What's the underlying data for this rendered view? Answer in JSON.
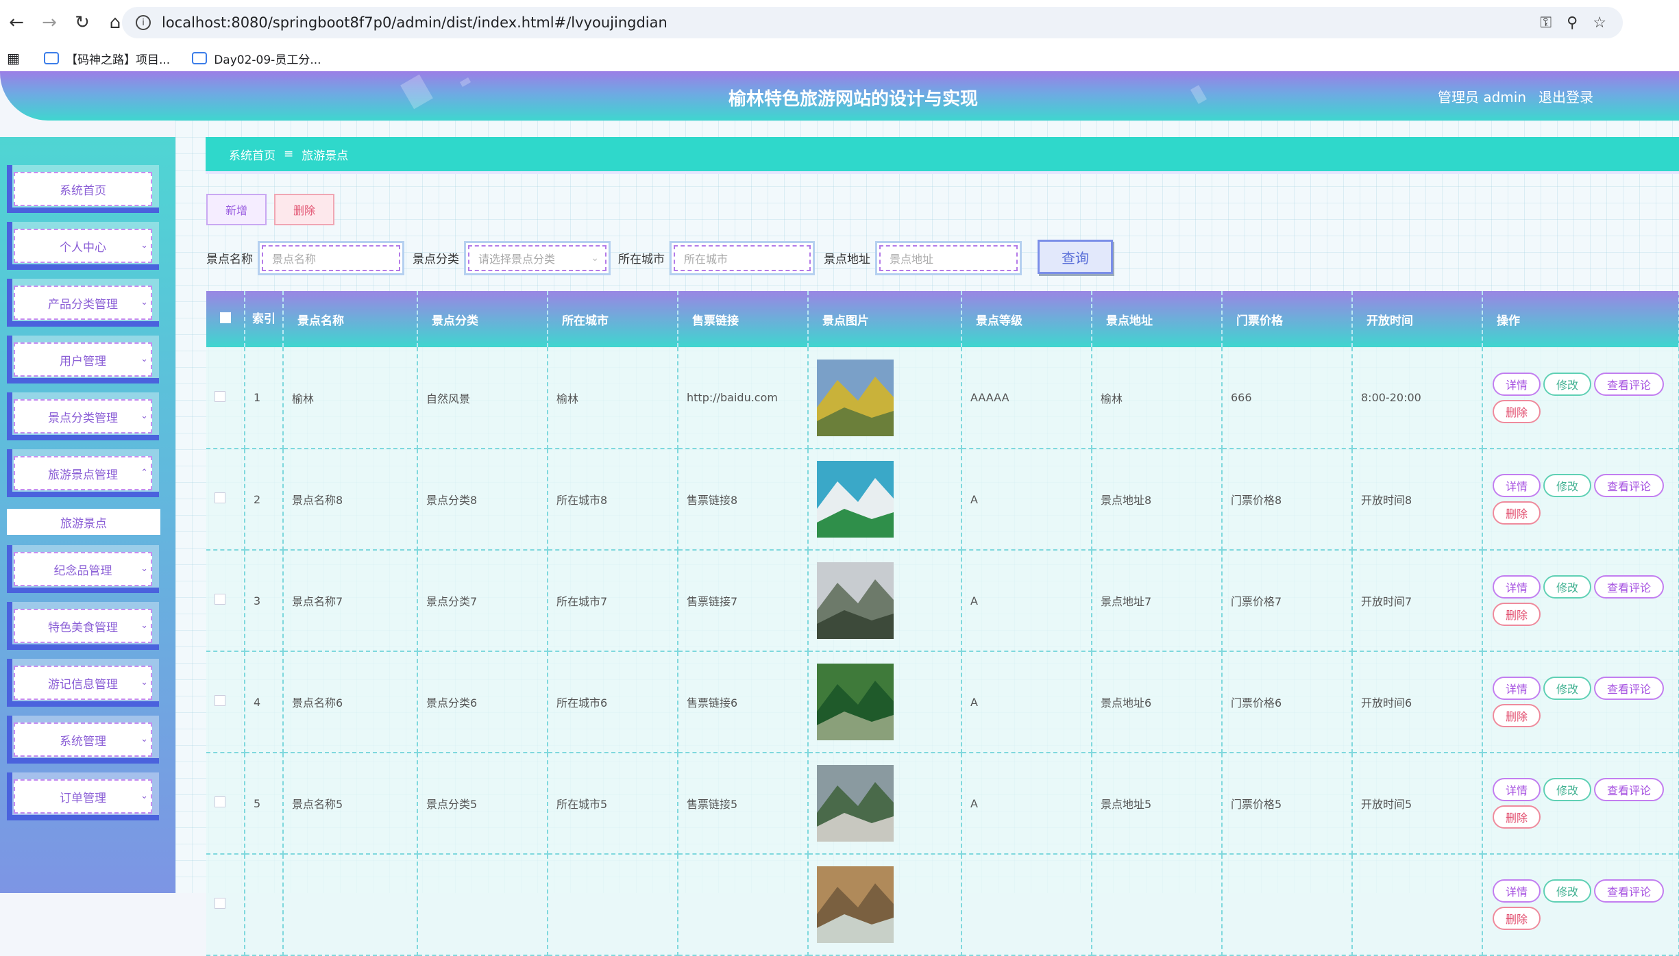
{
  "browser": {
    "url": "localhost:8080/springboot8f7p0/admin/dist/index.html#/lvyoujingdian",
    "bookmarks": [
      "【码神之路】项目...",
      "Day02-09-员工分..."
    ]
  },
  "header": {
    "title": "榆林特色旅游网站的设计与实现",
    "user": "管理员 admin",
    "logout": "退出登录"
  },
  "sidebar": {
    "items": [
      {
        "label": "系统首页"
      },
      {
        "label": "个人中心"
      },
      {
        "label": "产品分类管理"
      },
      {
        "label": "用户管理"
      },
      {
        "label": "景点分类管理"
      },
      {
        "label": "旅游景点管理"
      },
      {
        "label": "纪念品管理"
      },
      {
        "label": "特色美食管理"
      },
      {
        "label": "游记信息管理"
      },
      {
        "label": "系统管理"
      },
      {
        "label": "订单管理"
      }
    ],
    "active_sub": "旅游景点"
  },
  "breadcrumb": {
    "home": "系统首页",
    "current": "旅游景点"
  },
  "toolbar": {
    "add": "新增",
    "delete": "删除"
  },
  "filters": {
    "name_label": "景点名称",
    "name_placeholder": "景点名称",
    "category_label": "景点分类",
    "category_placeholder": "请选择景点分类",
    "city_label": "所在城市",
    "city_placeholder": "所在城市",
    "address_label": "景点地址",
    "address_placeholder": "景点地址",
    "query": "查询"
  },
  "table": {
    "columns": [
      "索引",
      "景点名称",
      "景点分类",
      "所在城市",
      "售票链接",
      "景点图片",
      "景点等级",
      "景点地址",
      "门票价格",
      "开放时间",
      "操作"
    ],
    "actions": {
      "detail": "详情",
      "edit": "修改",
      "review": "查看评论",
      "delete": "删除"
    },
    "rows": [
      {
        "index": "1",
        "name": "榆林",
        "category": "自然风景",
        "city": "榆林",
        "link": "http://baidu.com",
        "level": "AAAAA",
        "address": "榆林",
        "price": "666",
        "hours": "8:00-20:00"
      },
      {
        "index": "2",
        "name": "景点名称8",
        "category": "景点分类8",
        "city": "所在城市8",
        "link": "售票链接8",
        "level": "A",
        "address": "景点地址8",
        "price": "门票价格8",
        "hours": "开放时间8"
      },
      {
        "index": "3",
        "name": "景点名称7",
        "category": "景点分类7",
        "city": "所在城市7",
        "link": "售票链接7",
        "level": "A",
        "address": "景点地址7",
        "price": "门票价格7",
        "hours": "开放时间7"
      },
      {
        "index": "4",
        "name": "景点名称6",
        "category": "景点分类6",
        "city": "所在城市6",
        "link": "售票链接6",
        "level": "A",
        "address": "景点地址6",
        "price": "门票价格6",
        "hours": "开放时间6"
      },
      {
        "index": "5",
        "name": "景点名称5",
        "category": "景点分类5",
        "city": "所在城市5",
        "link": "售票链接5",
        "level": "A",
        "address": "景点地址5",
        "price": "门票价格5",
        "hours": "开放时间5"
      },
      {
        "index": "",
        "name": "",
        "category": "",
        "city": "",
        "link": "",
        "level": "",
        "address": "",
        "price": "",
        "hours": ""
      }
    ]
  }
}
